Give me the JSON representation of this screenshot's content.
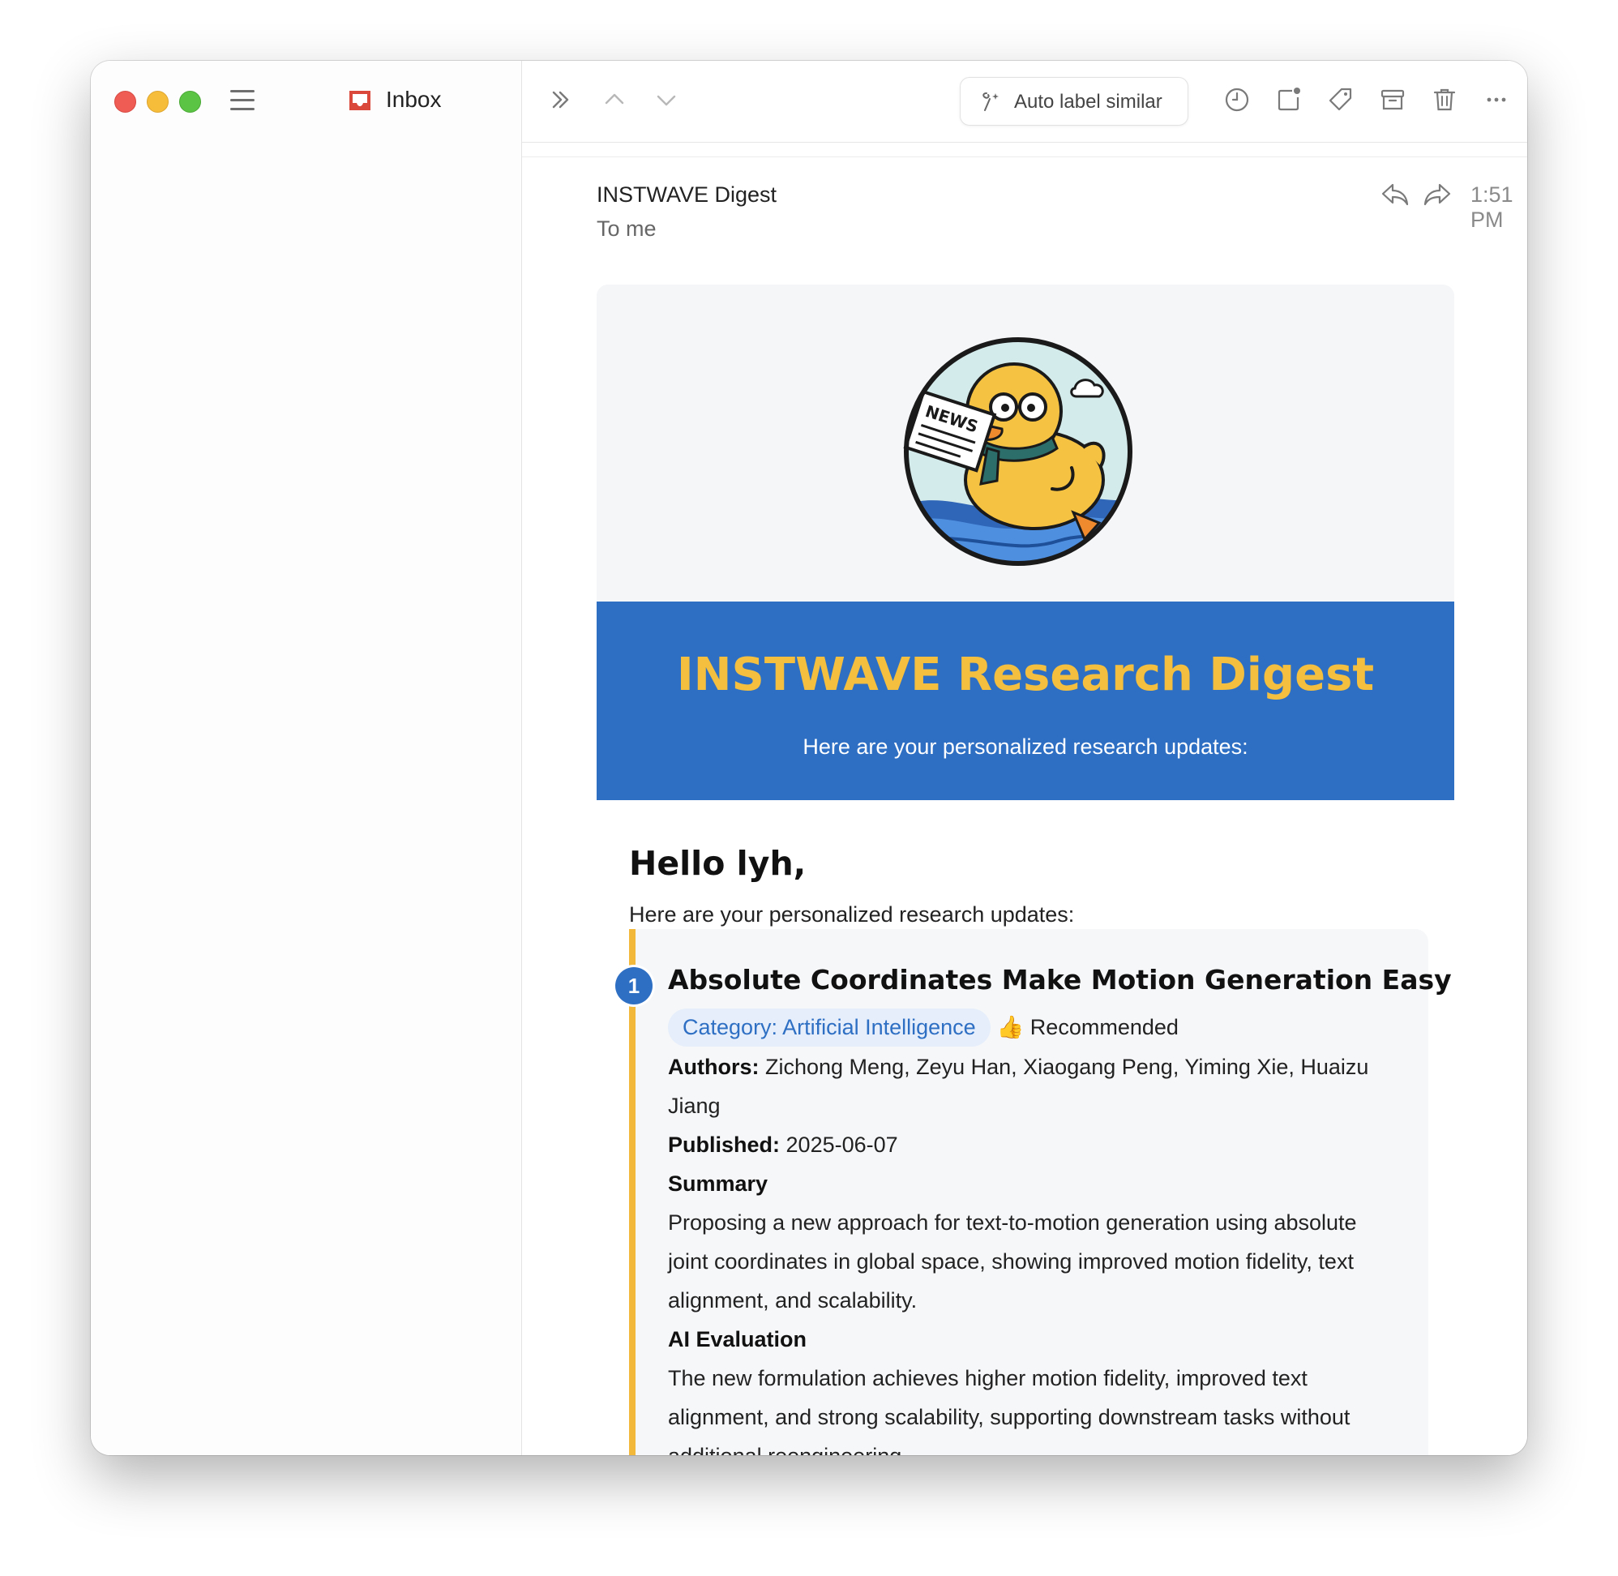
{
  "sidebar": {
    "title": "Inbox"
  },
  "toolbar": {
    "auto_label_button": "Auto label similar"
  },
  "message": {
    "sender": "INSTWAVE Digest",
    "recipient": "To me",
    "time": "1:51 PM"
  },
  "email": {
    "banner_title": "INSTWAVE Research Digest",
    "banner_subtitle": "Here are your personalized research updates:",
    "logo_text": "NEWS",
    "greeting": "Hello lyh,",
    "intro": "Here are your personalized research updates:",
    "papers": [
      {
        "number": "1",
        "title": "Absolute Coordinates Make Motion Generation Easy",
        "category": "Category: Artificial Intelligence",
        "recommendation": "👍 Recommended",
        "authors_label": "Authors:",
        "authors": "Zichong Meng, Zeyu Han, Xiaogang Peng, Yiming Xie, Huaizu Jiang",
        "published_label": "Published:",
        "published": "2025-06-07",
        "summary_label": "Summary",
        "summary": "Proposing a new approach for text-to-motion generation using absolute joint coordinates in global space, showing improved motion fidelity, text alignment, and scalability.",
        "evaluation_label": "AI Evaluation",
        "evaluation": "The new formulation achieves higher motion fidelity, improved text alignment, and strong scalability, supporting downstream tasks without additional reengineering."
      }
    ]
  },
  "colors": {
    "banner_bg": "#2e6fc4",
    "banner_title": "#f4bf3e",
    "accent_bar": "#f1b83a",
    "category_text": "#2e6fc4",
    "category_bg": "#e5eefa"
  }
}
